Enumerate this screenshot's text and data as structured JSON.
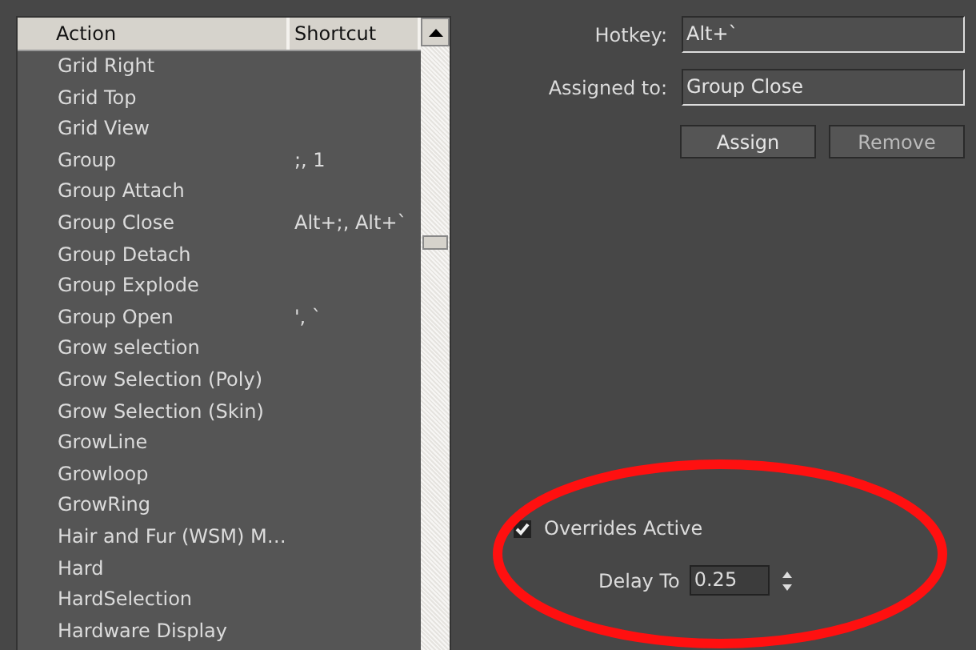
{
  "table": {
    "columns": [
      "Action",
      "Shortcut"
    ],
    "rows": [
      {
        "action": "Grid Right",
        "shortcut": ""
      },
      {
        "action": "Grid Top",
        "shortcut": ""
      },
      {
        "action": "Grid View",
        "shortcut": ""
      },
      {
        "action": "Group",
        "shortcut": ";, 1"
      },
      {
        "action": "Group Attach",
        "shortcut": ""
      },
      {
        "action": "Group Close",
        "shortcut": "Alt+;, Alt+`"
      },
      {
        "action": "Group Detach",
        "shortcut": ""
      },
      {
        "action": "Group Explode",
        "shortcut": ""
      },
      {
        "action": "Group Open",
        "shortcut": "', `"
      },
      {
        "action": "Grow selection",
        "shortcut": ""
      },
      {
        "action": "Grow Selection (Poly)",
        "shortcut": ""
      },
      {
        "action": "Grow Selection (Skin)",
        "shortcut": ""
      },
      {
        "action": "GrowLine",
        "shortcut": ""
      },
      {
        "action": "Growloop",
        "shortcut": ""
      },
      {
        "action": "GrowRing",
        "shortcut": ""
      },
      {
        "action": "Hair and Fur (WSM) M…",
        "shortcut": ""
      },
      {
        "action": "Hard",
        "shortcut": ""
      },
      {
        "action": "HardSelection",
        "shortcut": ""
      },
      {
        "action": "Hardware Display",
        "shortcut": ""
      }
    ]
  },
  "hotkey": {
    "label": "Hotkey:",
    "value": "Alt+`"
  },
  "assigned_to": {
    "label": "Assigned to:",
    "value": "Group Close"
  },
  "buttons": [
    "Assign",
    "Remove"
  ],
  "overrides_active": {
    "label": "Overrides Active",
    "checked": true
  },
  "delay_to": {
    "label": "Delay To",
    "value": "0.25"
  }
}
